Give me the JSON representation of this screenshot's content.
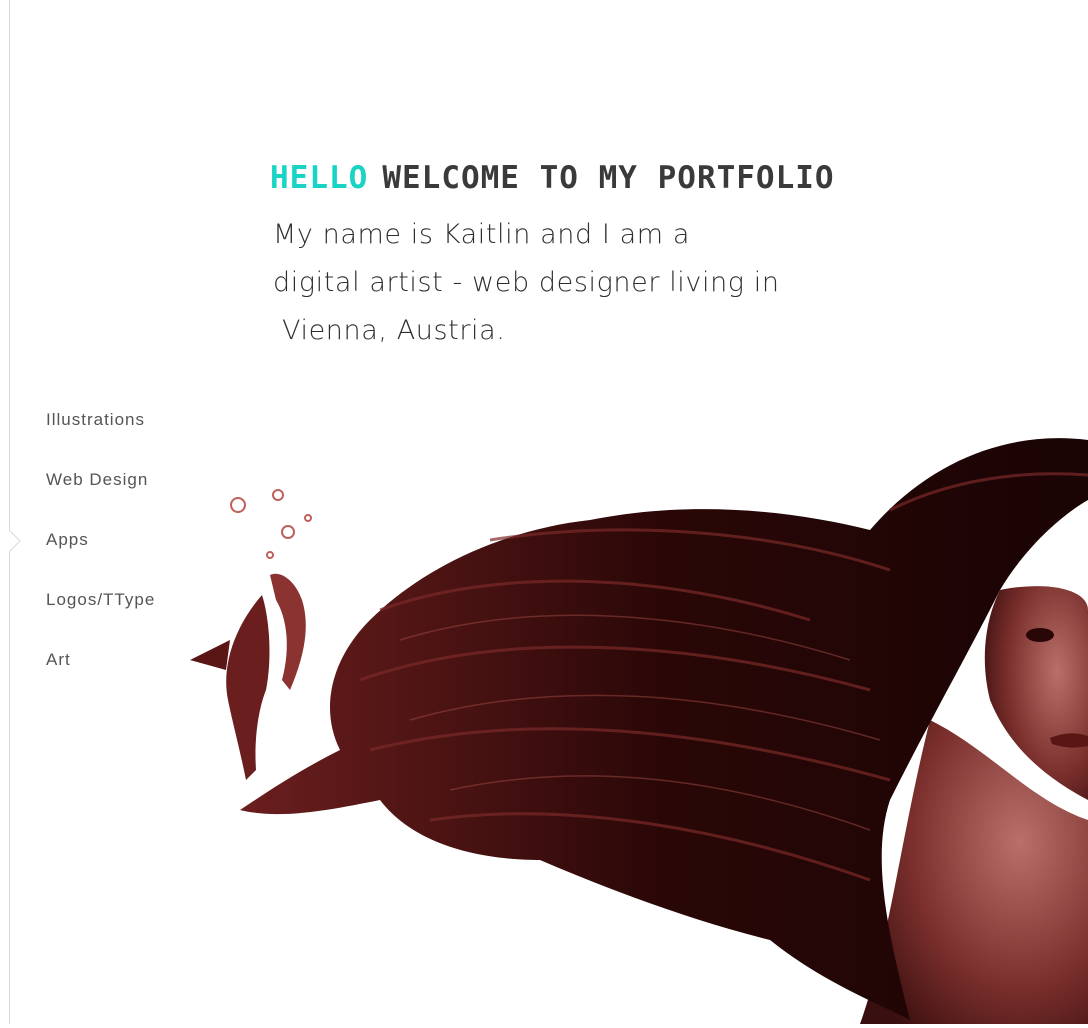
{
  "header": {
    "hello": "HELLO",
    "welcome": "WELCOME TO MY PORTFOLIO"
  },
  "intro": {
    "line1": "My name is Kaitlin and I am a",
    "line2": "digital artist - web designer living in",
    "line3": "Vienna, Austria."
  },
  "nav": {
    "items": [
      {
        "label": "Illustrations"
      },
      {
        "label": "Web Design"
      },
      {
        "label": "Apps"
      },
      {
        "label": "Logos/TType"
      },
      {
        "label": "Art"
      }
    ],
    "active": "Apps"
  },
  "colors": {
    "accent": "#19d3c5",
    "heading": "#3a3a3a",
    "artwork": "#6b1e1e"
  },
  "artwork": {
    "subject": "illustration-woman-flowing-hair-koi-fish",
    "icon": "artwork-illustration"
  }
}
